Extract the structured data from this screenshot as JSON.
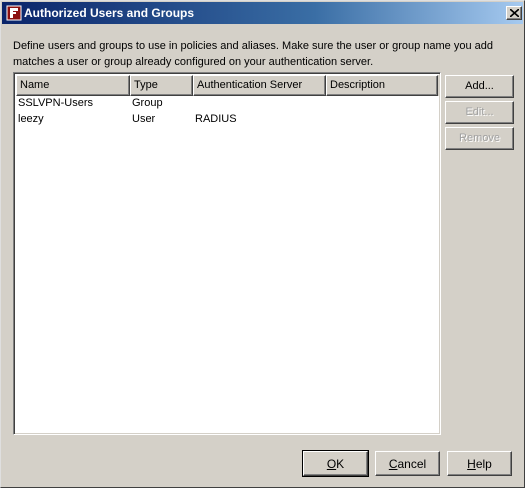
{
  "window": {
    "title": "Authorized Users and Groups"
  },
  "description": {
    "line1": "Define users and groups to use in policies and aliases. Make sure the user or group name you add",
    "line2": "matches a user or group already configured on your authentication server."
  },
  "table": {
    "columns": [
      "Name",
      "Type",
      "Authentication Server",
      "Description"
    ],
    "rows": [
      {
        "name": "SSLVPN-Users",
        "type": "Group",
        "auth_server": "",
        "description": ""
      },
      {
        "name": "leezy",
        "type": "User",
        "auth_server": "RADIUS",
        "description": ""
      }
    ]
  },
  "side_buttons": {
    "add": "Add...",
    "edit": "Edit...",
    "remove": "Remove"
  },
  "bottom_buttons": {
    "ok_mnemonic": "O",
    "ok_rest": "K",
    "cancel_mnemonic": "C",
    "cancel_rest": "ancel",
    "help_mnemonic": "H",
    "help_rest": "elp"
  },
  "icons": {
    "app": "firebox-app-icon",
    "close": "close-icon"
  },
  "colors": {
    "titlebar_start": "#0a246a",
    "titlebar_end": "#a6caf0",
    "dialog_bg": "#d4d0c8",
    "list_bg": "#ffffff",
    "disabled_text": "#a0a0a0"
  }
}
